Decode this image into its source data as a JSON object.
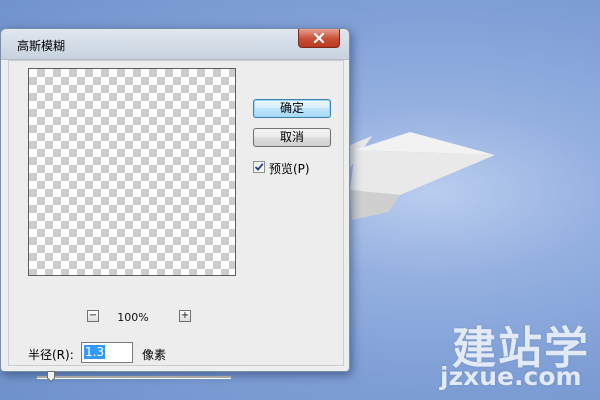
{
  "window": {
    "title": "高斯模糊"
  },
  "buttons": {
    "ok_label": "确定",
    "cancel_label": "取消"
  },
  "preview_checkbox": {
    "label": "预览(P)",
    "checked": true
  },
  "zoom": {
    "minus_label": "−",
    "plus_label": "+",
    "value": "100%"
  },
  "radius": {
    "label": "半径(R):",
    "value": "1.3",
    "unit": "像素",
    "slider_level": 0.07
  },
  "watermark": {
    "logo": "建站学",
    "url": "jzxue.com"
  },
  "colors": {
    "desktop": "#7f9fd6",
    "close_button": "#c84e35",
    "selection": "#3399ff",
    "default_button": "#bee6fd"
  },
  "icons": {
    "close": "close-icon",
    "check": "check-icon",
    "slider": "slider-thumb-icon"
  }
}
